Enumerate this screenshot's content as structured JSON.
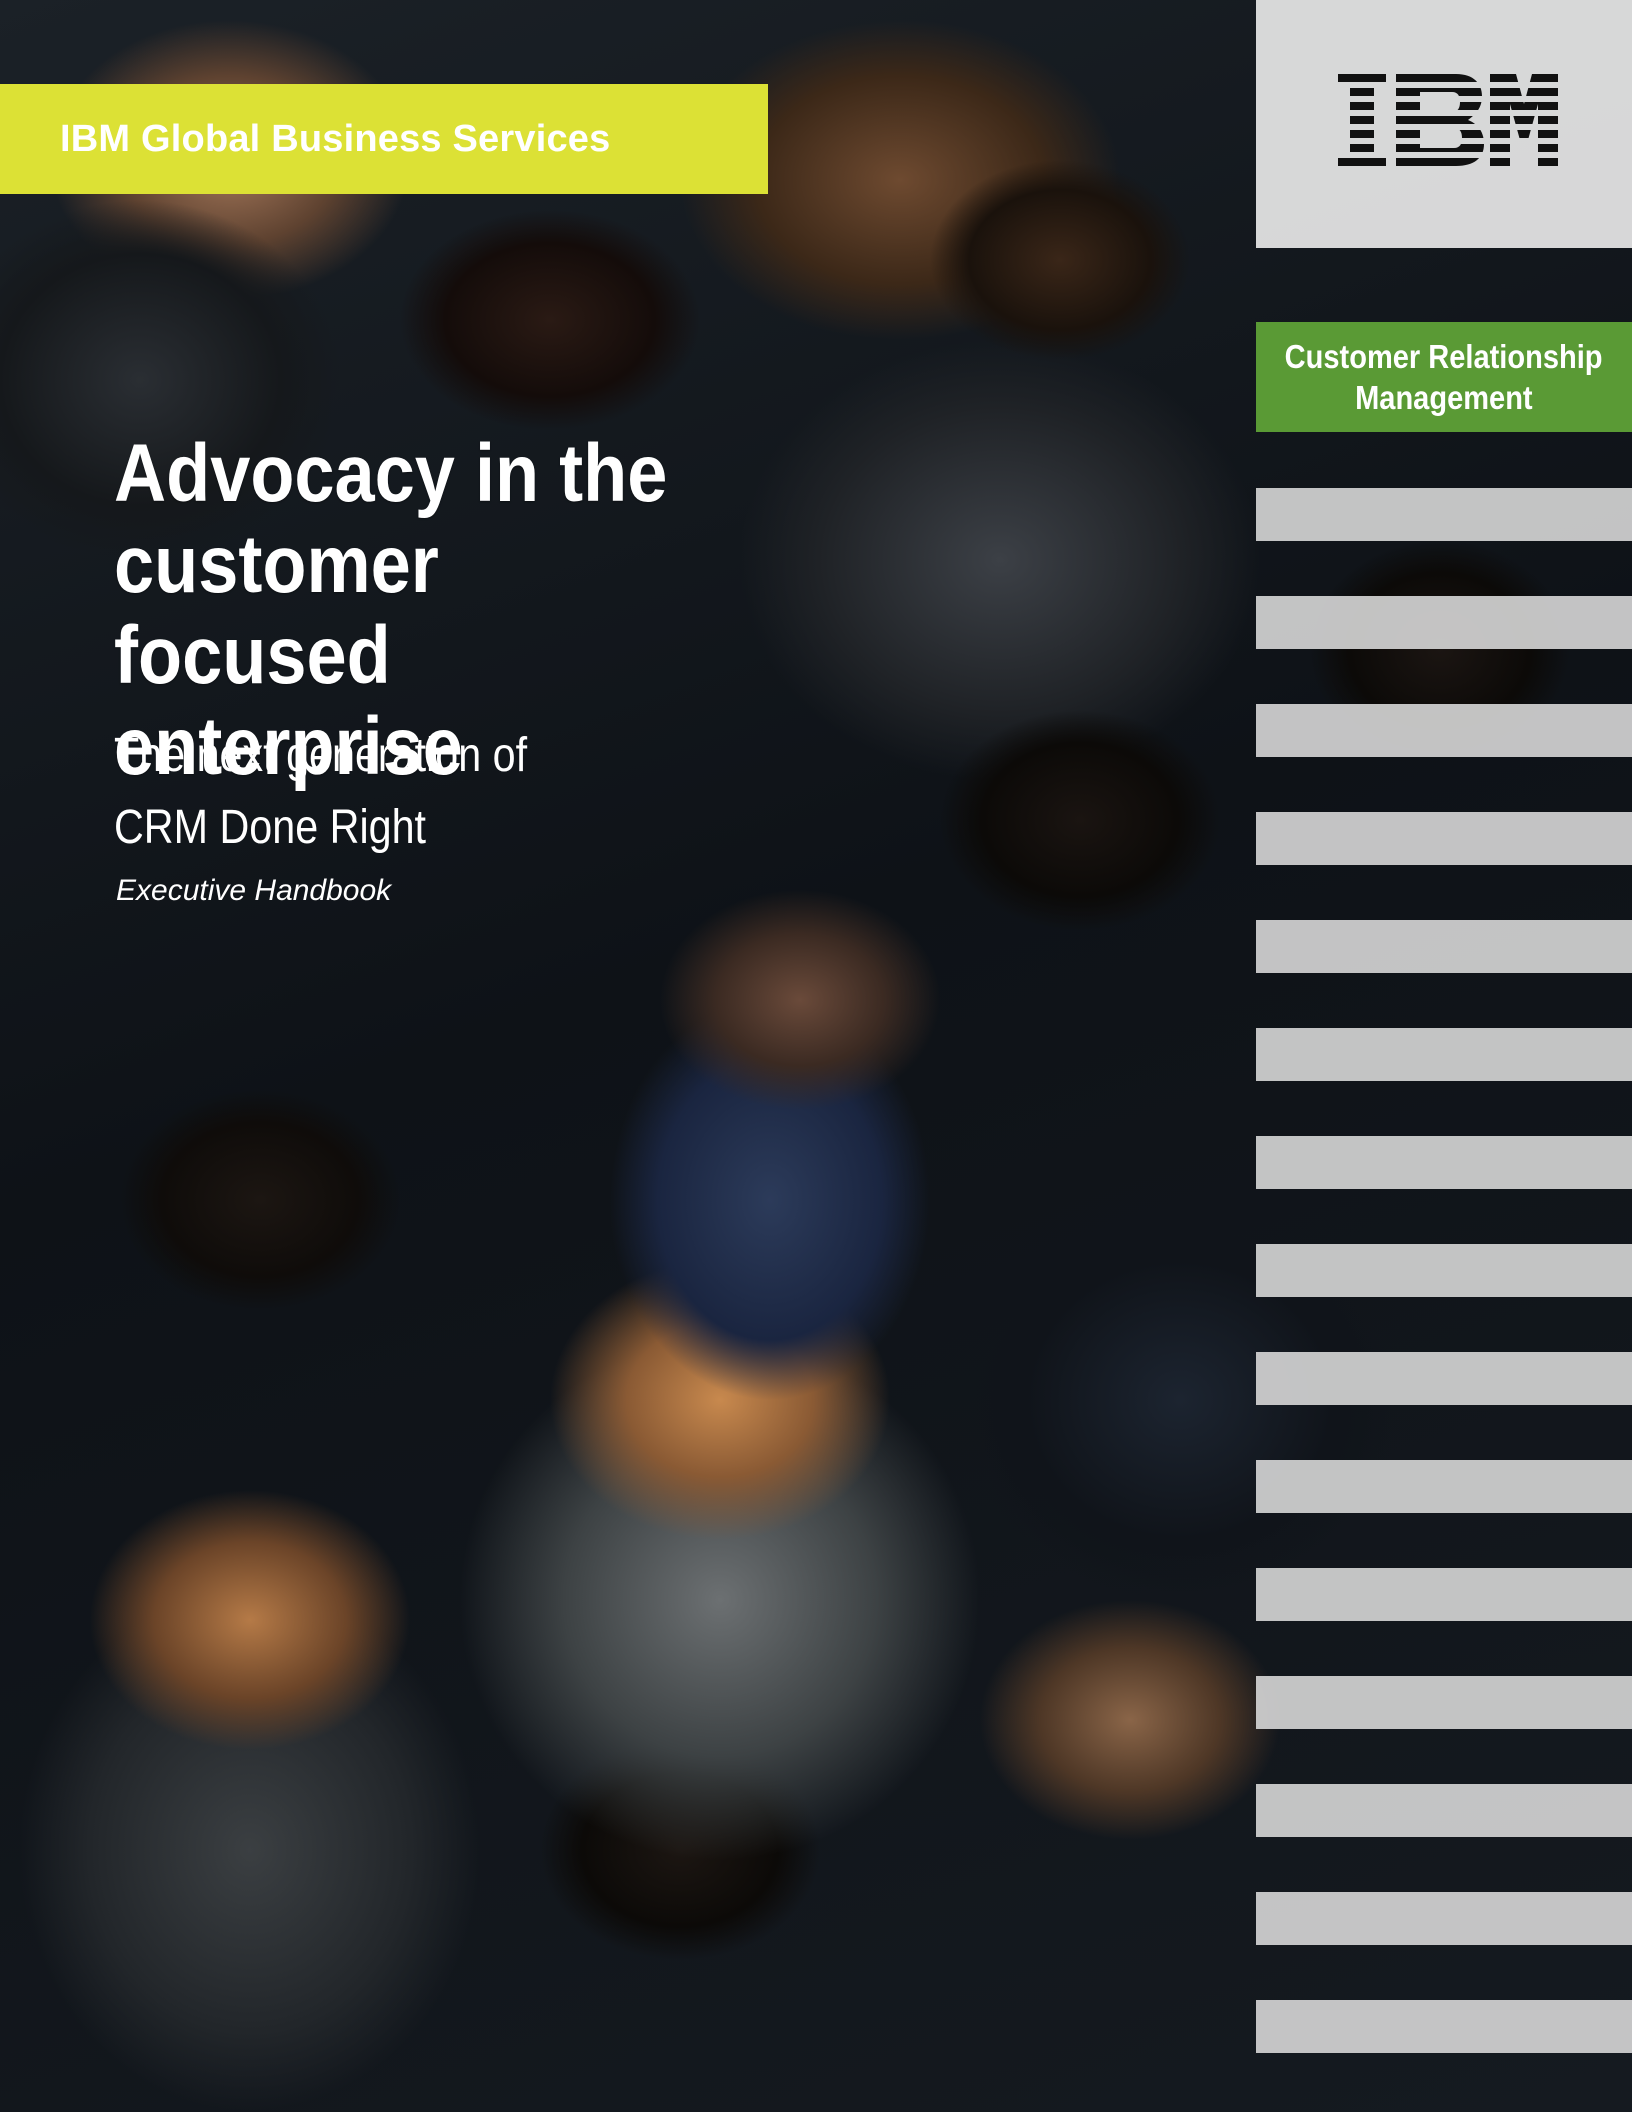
{
  "header": {
    "service_label": "IBM Global Business Services",
    "brand_logo": "IBM"
  },
  "category_tag": {
    "line1": "Customer Relationship",
    "line2": "Management"
  },
  "cover": {
    "title_line1": "Advocacy in the",
    "title_line2": "customer focused",
    "title_line3": "enterprise",
    "subtitle_line1": "The next generation of",
    "subtitle_line2": "CRM Done Right",
    "document_type": "Executive Handbook"
  },
  "colors": {
    "service_band": "#dce135",
    "category_tag": "#5a9a35",
    "stripes": "#d7d7d7",
    "text": "#ffffff",
    "logo": "#111111"
  }
}
